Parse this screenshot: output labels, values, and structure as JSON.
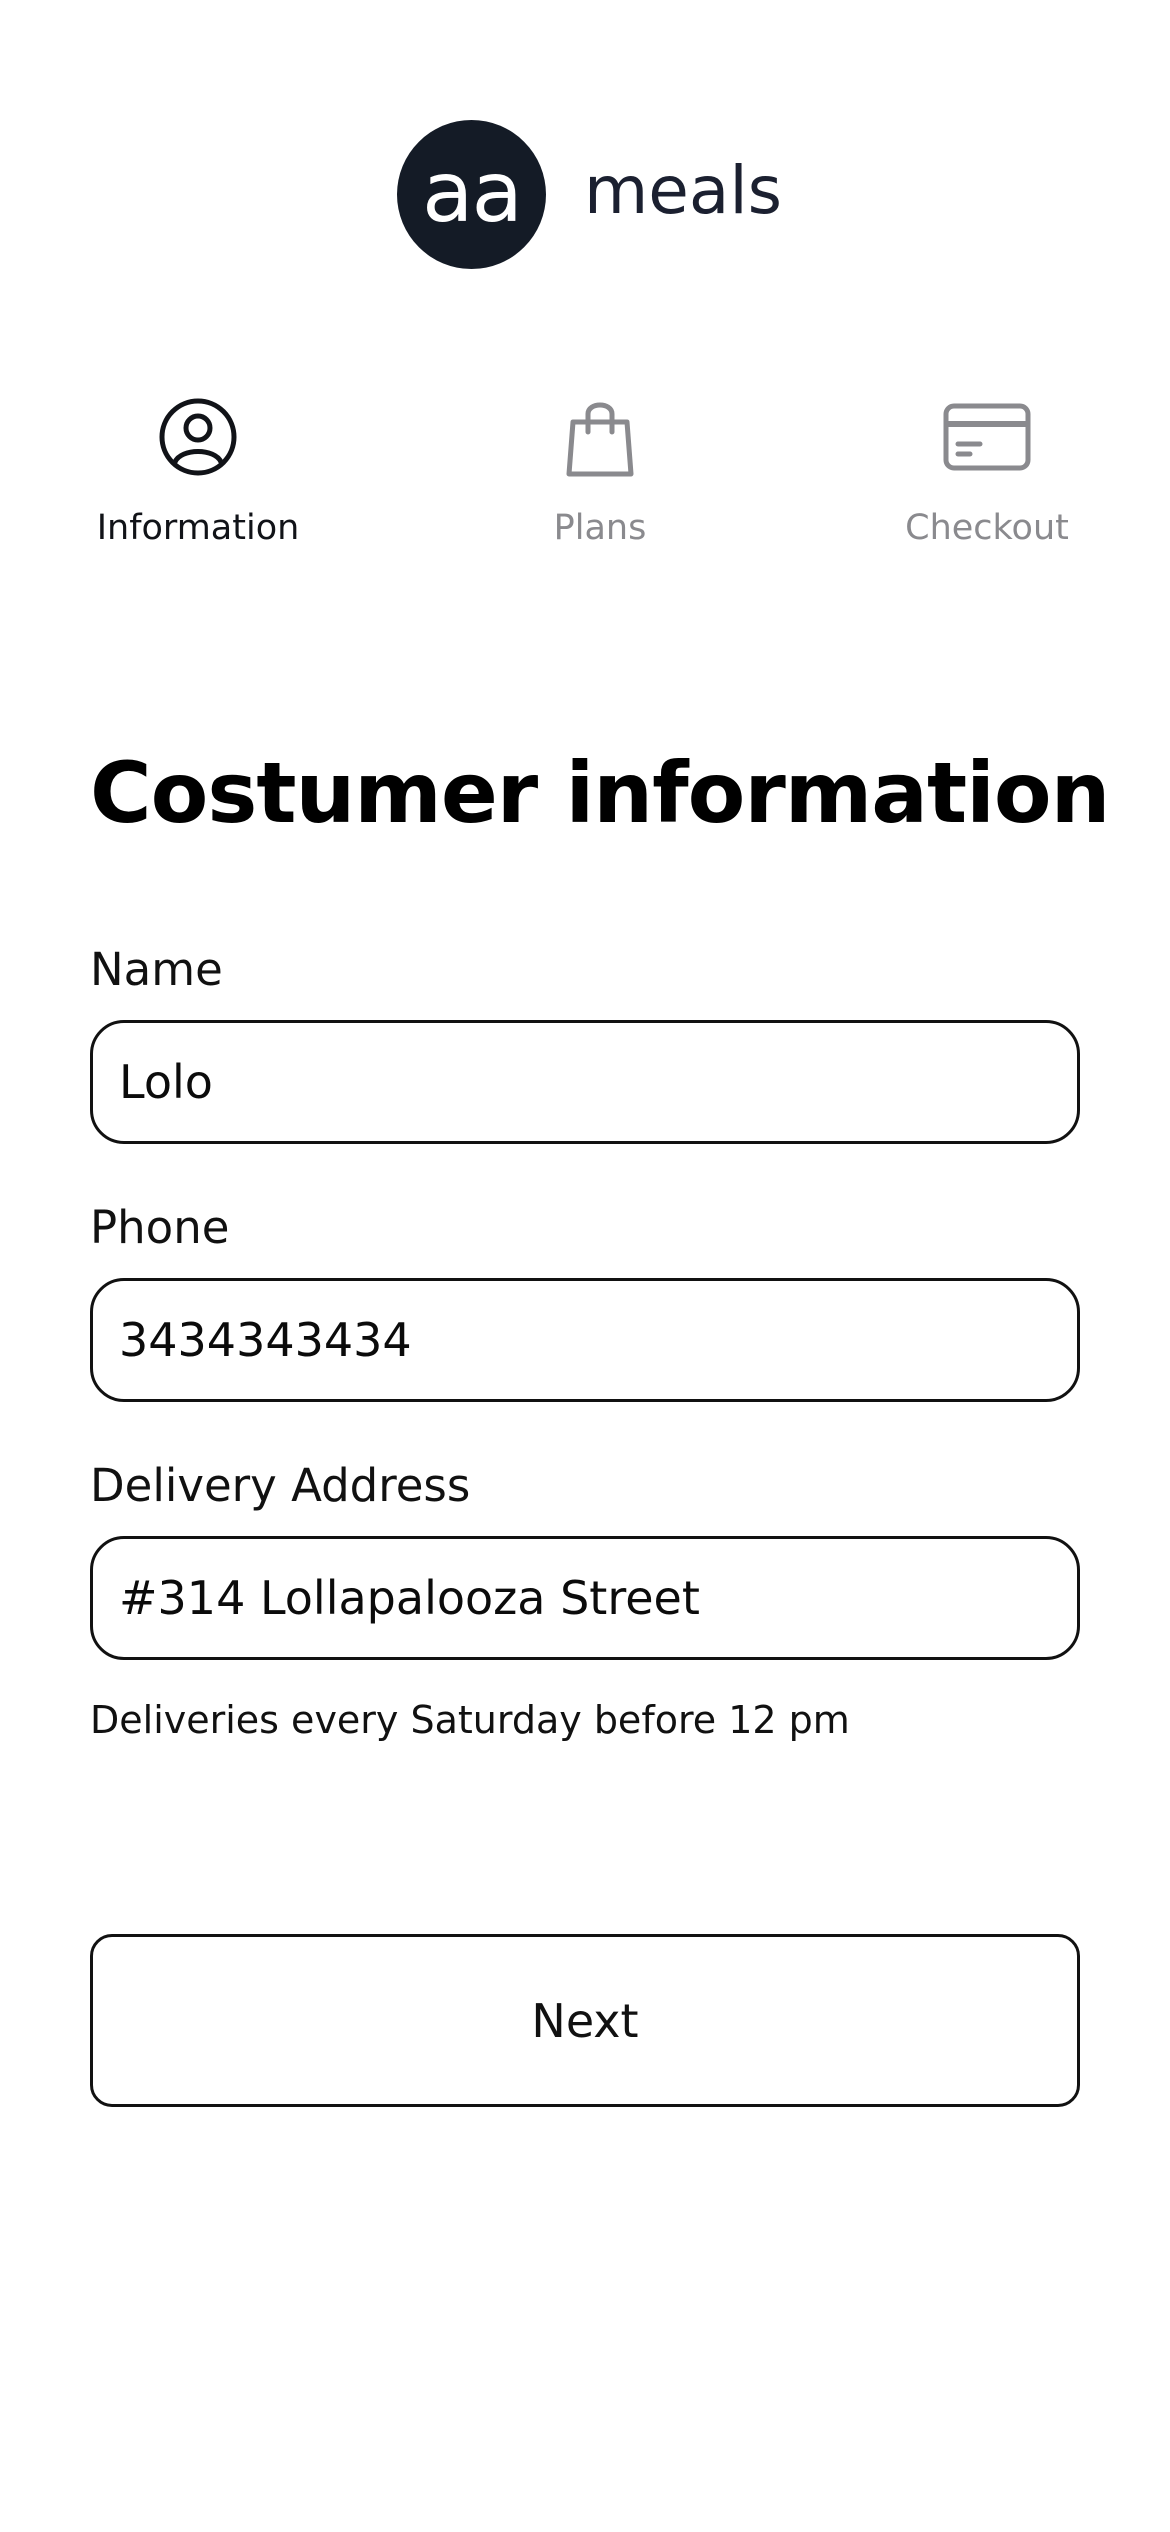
{
  "brand": {
    "badge_text": "aa",
    "name": "meals",
    "badge_color": "#141b26"
  },
  "steps": [
    {
      "label": "Information",
      "icon": "user-circle-icon",
      "state": "active"
    },
    {
      "label": "Plans",
      "icon": "shopping-bag-icon",
      "state": "inactive"
    },
    {
      "label": "Checkout",
      "icon": "credit-card-icon",
      "state": "inactive"
    }
  ],
  "form": {
    "title": "Costumer information",
    "fields": [
      {
        "label": "Name",
        "value": "Lolo"
      },
      {
        "label": "Phone",
        "value": "3434343434"
      },
      {
        "label": "Delivery Address",
        "value": "#314 Lollapalooza Street"
      }
    ],
    "hint": "Deliveries every Saturday before 12 pm",
    "next_label": "Next"
  },
  "colors": {
    "active_step": "#111318",
    "inactive_step": "#8a8a8e",
    "border": "#111111"
  }
}
